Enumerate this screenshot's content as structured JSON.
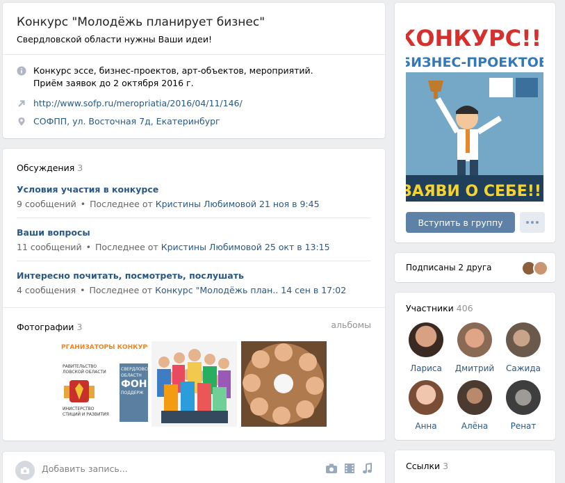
{
  "header": {
    "title": "Конкурс \"Молодёжь планирует бизнес\"",
    "status": "Свердловской области нужны Ваши идеи!",
    "description_line1": "Конкурс эссе, бизнес-проектов, арт-объектов, мероприятий.",
    "description_line2": "Приём заявок до 2 октября 2016 г.",
    "website": "http://www.sofp.ru/meropriatia/2016/04/11/146/",
    "address": "СОФПП, ул. Восточная 7д, Екатеринбург"
  },
  "discussions": {
    "title": "Обсуждения",
    "count": "3",
    "items": [
      {
        "title": "Условия участия в конкурсе",
        "count": "9 сообщений",
        "last_prefix": "Последнее от",
        "last_author": "Кристины Любимовой",
        "last_time": "21 ноя в 9:45"
      },
      {
        "title": "Ваши вопросы",
        "count": "11 сообщений",
        "last_prefix": "Последнее от",
        "last_author": "Кристины Любимовой",
        "last_time": "25 окт в 13:15"
      },
      {
        "title": "Интересно почитать, посмотреть, послушать",
        "count": "4 сообщения",
        "last_prefix": "Последнее от",
        "last_author": "Конкурс \"Молодёжь план..",
        "last_time": "14 сен в 17:02"
      }
    ]
  },
  "photos": {
    "title": "Фотографии",
    "count": "3",
    "albums_link": "альбомы",
    "photo1_heading": "РГАНИЗАТОРЫ КОНКУРСА",
    "photo1_line1": "РАВИТЕЛЬСТВО",
    "photo1_line2": "ЛОВСКОЙ ОБЛАСТИ",
    "photo1_line3": "ИНИСТЕРСТВО",
    "photo1_line4": "СТИЦИЙ И РАЗВИТИЯ",
    "photo1_fund1": "СВЕРДЛОВСК",
    "photo1_fund2": "ОБЛАСТН",
    "photo1_fund3": "ФОН",
    "photo1_fund4": "ПОДДЕРЖ"
  },
  "post_box": {
    "placeholder": "Добавить запись..."
  },
  "cover": {
    "line1": "КОНКУРС!!!",
    "line2": "БИЗНЕС-ПРОЕКТОВ",
    "line3": "ЗАЯВИ О СЕБЕ!!!"
  },
  "actions": {
    "join_label": "Вступить в группу"
  },
  "friends": {
    "text": "Подписаны 2 друга"
  },
  "members": {
    "title": "Участники",
    "count": "406",
    "items": [
      {
        "name": "Лариса"
      },
      {
        "name": "Дмитрий"
      },
      {
        "name": "Сажида"
      },
      {
        "name": "Анна"
      },
      {
        "name": "Алёна"
      },
      {
        "name": "Ренат"
      }
    ]
  },
  "links": {
    "title": "Ссылки",
    "count": "3"
  },
  "colors": {
    "link": "#2a5885",
    "button": "#5e81a8",
    "background": "#edeef0"
  }
}
